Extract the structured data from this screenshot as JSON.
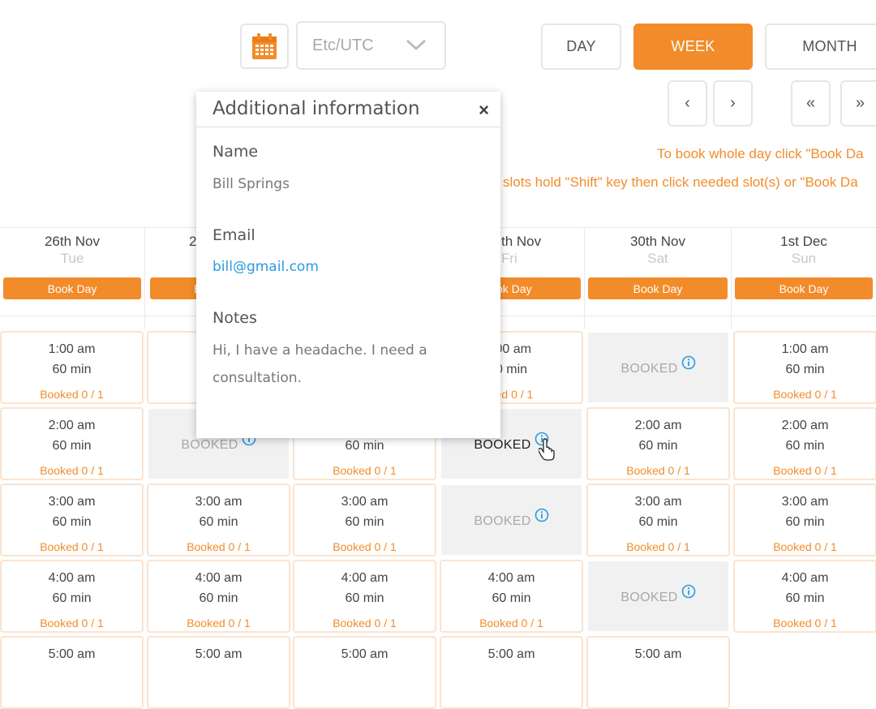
{
  "toolbar": {
    "calendar_icon": "calendar-icon",
    "timezone": "Etc/UTC",
    "views": [
      {
        "label": "DAY",
        "active": false
      },
      {
        "label": "WEEK",
        "active": true
      },
      {
        "label": "MONTH",
        "active": false
      }
    ],
    "nav": [
      "‹",
      "›",
      "«",
      "»"
    ],
    "hint_line1": "To book whole day click \"Book Da",
    "hint_line2": "slots hold \"Shift\" key then click needed slot(s) or \"Book Da"
  },
  "days": [
    {
      "date": "26th Nov",
      "dow": "Tue",
      "book_label": "Book Day"
    },
    {
      "date": "2",
      "dow": "",
      "book_label": "B"
    },
    {
      "date": "",
      "dow": "",
      "book_label": ""
    },
    {
      "date": "th Nov",
      "dow": "Fri",
      "book_label": "ok Day"
    },
    {
      "date": "30th Nov",
      "dow": "Sat",
      "book_label": "Book Day"
    },
    {
      "date": "1st Dec",
      "dow": "Sun",
      "book_label": "Book Day"
    }
  ],
  "slots": {
    "r0": [
      {
        "time": "1:00 am",
        "dur": "60 min",
        "status": "Booked 0 / 1"
      },
      {
        "time": "",
        "dur": "",
        "status": "Bo"
      },
      {
        "time": "",
        "dur": "",
        "status": ""
      },
      {
        "time": ":00 am",
        "dur": "0 min",
        "status": "ked 0 / 1"
      },
      {
        "booked": "BOOKED"
      },
      {
        "time": "1:00 am",
        "dur": "60 min",
        "status": "Booked 0 / 1"
      }
    ],
    "r1": [
      {
        "time": "2:00 am",
        "dur": "60 min",
        "status": "Booked 0 / 1"
      },
      {
        "booked": "BOOKED"
      },
      {
        "time": "",
        "dur": "60 min",
        "status": "Booked 0 / 1"
      },
      {
        "booked": "BOOKED"
      },
      {
        "time": "2:00 am",
        "dur": "60 min",
        "status": "Booked 0 / 1"
      },
      {
        "time": "2:00 am",
        "dur": "60 min",
        "status": "Booked 0 / 1"
      }
    ],
    "r2": [
      {
        "time": "3:00 am",
        "dur": "60 min",
        "status": "Booked 0 / 1"
      },
      {
        "time": "3:00 am",
        "dur": "60 min",
        "status": "Booked 0 / 1"
      },
      {
        "time": "3:00 am",
        "dur": "60 min",
        "status": "Booked 0 / 1"
      },
      {
        "booked": "BOOKED"
      },
      {
        "time": "3:00 am",
        "dur": "60 min",
        "status": "Booked 0 / 1"
      },
      {
        "time": "3:00 am",
        "dur": "60 min",
        "status": "Booked 0 / 1"
      }
    ],
    "r3": [
      {
        "time": "4:00 am",
        "dur": "60 min",
        "status": "Booked 0 / 1"
      },
      {
        "time": "4:00 am",
        "dur": "60 min",
        "status": "Booked 0 / 1"
      },
      {
        "time": "4:00 am",
        "dur": "60 min",
        "status": "Booked 0 / 1"
      },
      {
        "time": "4:00 am",
        "dur": "60 min",
        "status": "Booked 0 / 1"
      },
      {
        "booked": "BOOKED"
      },
      {
        "time": "4:00 am",
        "dur": "60 min",
        "status": "Booked 0 / 1"
      }
    ],
    "r4": [
      {
        "time": "5:00 am"
      },
      {
        "time": "5:00 am"
      },
      {
        "time": "5:00 am"
      },
      {
        "time": "5:00 am"
      },
      {
        "time": "5:00 am"
      }
    ]
  },
  "popup": {
    "title": "Additional information",
    "close": "×",
    "name_label": "Name",
    "name_value": "Bill Springs",
    "email_label": "Email",
    "email_value": "bill@gmail.com",
    "notes_label": "Notes",
    "notes_value": "Hi, I have a headache. I need a consultation."
  },
  "colors": {
    "accent": "#f28c2b",
    "link": "#2a9be0",
    "booked_bg": "#f1f1f1",
    "info_icon": "#2a9be0"
  }
}
